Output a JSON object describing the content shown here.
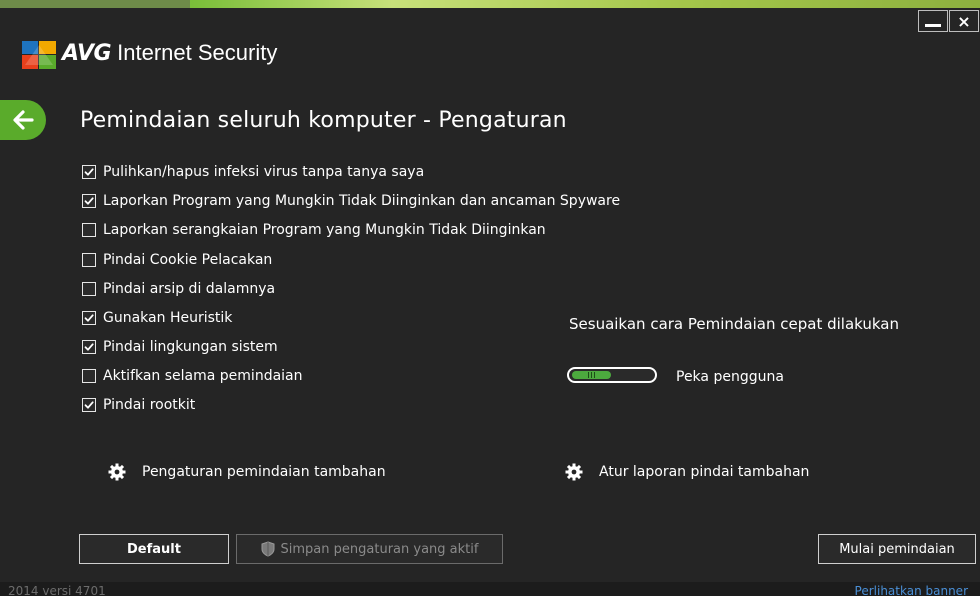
{
  "app": {
    "brand": "AVG",
    "product": "Internet Security"
  },
  "window": {
    "minimize_glyph": "_",
    "close_glyph": "×"
  },
  "page": {
    "title": "Pemindaian seluruh komputer - Pengaturan"
  },
  "options": [
    {
      "label": "Pulihkan/hapus infeksi virus tanpa tanya saya",
      "checked": true
    },
    {
      "label": "Laporkan Program yang Mungkin Tidak Diinginkan dan ancaman Spyware",
      "checked": true
    },
    {
      "label": "Laporkan serangkaian Program yang Mungkin Tidak Diinginkan",
      "checked": false
    },
    {
      "label": "Pindai Cookie Pelacakan",
      "checked": false
    },
    {
      "label": "Pindai arsip di dalamnya",
      "checked": false
    },
    {
      "label": "Gunakan Heuristik",
      "checked": true
    },
    {
      "label": "Pindai lingkungan sistem",
      "checked": true
    },
    {
      "label": "Aktifkan selama pemindaian",
      "checked": false
    },
    {
      "label": "Pindai rootkit",
      "checked": true
    }
  ],
  "quick_scan": {
    "title": "Sesuaikan cara Pemindaian cepat dilakukan",
    "slider_label": "Peka pengguna",
    "slider_level": 0.5
  },
  "links": {
    "additional_scan_settings": "Pengaturan pemindaian tambahan",
    "additional_report_settings": "Atur laporan pindai tambahan"
  },
  "buttons": {
    "default": "Default",
    "save": "Simpan pengaturan yang aktif",
    "start": "Mulai pemindaian"
  },
  "footer": {
    "version": "2014 versi 4701",
    "banner": "Perlihatkan banner"
  },
  "colors": {
    "accent_green": "#5aab2b",
    "background": "#252525",
    "link_blue": "#4a8fd6"
  },
  "icons": {
    "back": "arrow-left-icon",
    "gear": "gear-icon",
    "shield": "shield-icon",
    "check": "checkmark-icon"
  }
}
